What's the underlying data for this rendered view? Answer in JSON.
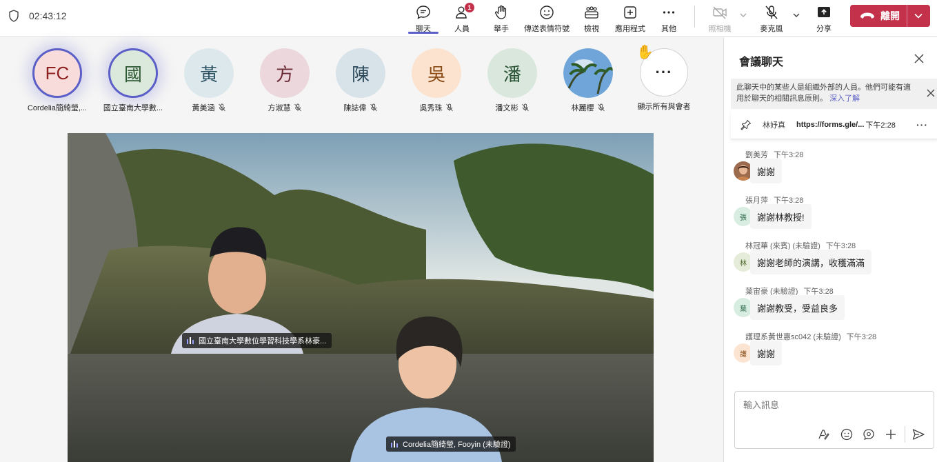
{
  "topbar": {
    "timer": "02:43:12",
    "tools": {
      "chat": "聊天",
      "people": "人員",
      "people_badge": "1",
      "raise_hand": "舉手",
      "reactions": "傳送表情符號",
      "view": "檢視",
      "apps": "應用程式",
      "more": "其他",
      "camera": "照相機",
      "mic": "麥克風",
      "share": "分享"
    },
    "leave": "離開"
  },
  "roster": [
    {
      "initials": "FC",
      "name": "Cordelia簡綺瑩,...",
      "bg": "#f8dcdc",
      "fg": "#8e2020",
      "active": true,
      "muted": false
    },
    {
      "initials": "國",
      "name": "國立臺南大學數...",
      "bg": "#dbe8dc",
      "fg": "#2f5a35",
      "active": true,
      "muted": false
    },
    {
      "initials": "黃",
      "name": "黃美涵",
      "bg": "#dde8ed",
      "fg": "#2f5464",
      "active": false,
      "muted": true
    },
    {
      "initials": "方",
      "name": "方淑慧",
      "bg": "#ecd8dc",
      "fg": "#6b2b36",
      "active": false,
      "muted": true
    },
    {
      "initials": "陳",
      "name": "陳誌偉",
      "bg": "#d7e2e9",
      "fg": "#2e4b5c",
      "active": false,
      "muted": true
    },
    {
      "initials": "吳",
      "name": "吳秀珠",
      "bg": "#fbe3cf",
      "fg": "#8a4a14",
      "active": false,
      "muted": true
    },
    {
      "initials": "潘",
      "name": "潘文彬",
      "bg": "#d9e7dd",
      "fg": "#2c5537",
      "active": false,
      "muted": true
    },
    {
      "initials": "",
      "name": "林麗櫻",
      "bg": "#6fa5d8",
      "fg": "#ffffff",
      "active": false,
      "muted": true
    }
  ],
  "show_all": {
    "label": "顯示所有與會者",
    "icon": "raised-hand-icon"
  },
  "stage": {
    "tag_top": "國立臺南大學數位學習科技學系林豪...",
    "tag_bottom": "Cordelia簡綺瑩, Fooyin (未驗證)"
  },
  "chat": {
    "title": "會議聊天",
    "notice": "此聊天中的某些人是組織外部的人員。他們可能有適用於聊天的相關訊息原則。",
    "notice_link": "深入了解",
    "pinned": {
      "user": "林妤真",
      "link": "https://forms.gle/...",
      "time": "下午2:28"
    },
    "messages": [
      {
        "sender": "劉美芳",
        "time": "下午3:28",
        "text": "謝謝",
        "avatar": "",
        "bg": "#b07a5a",
        "fg": "#ffffff"
      },
      {
        "sender": "張月萍",
        "time": "下午3:28",
        "text": "謝謝林教授!",
        "avatar": "張",
        "bg": "#d9ede3",
        "fg": "#2b6a48"
      },
      {
        "sender": "林冠華 (來賓) (未驗證)",
        "time": "下午3:28",
        "text": "謝謝老師的演講，收穫滿滿",
        "avatar": "林",
        "bg": "#e5ecd9",
        "fg": "#4b6a2b"
      },
      {
        "sender": "葉宙豪 (未驗證)",
        "time": "下午3:28",
        "text": "謝謝教受，受益良多",
        "avatar": "葉",
        "bg": "#d8ede2",
        "fg": "#2b6a48"
      },
      {
        "sender": "護理系黃世惠sc042 (未驗證)",
        "time": "下午3:28",
        "text": "謝謝",
        "avatar": "護",
        "bg": "#fbe5d2",
        "fg": "#8a4a14"
      }
    ],
    "compose_placeholder": "輸入訊息"
  }
}
